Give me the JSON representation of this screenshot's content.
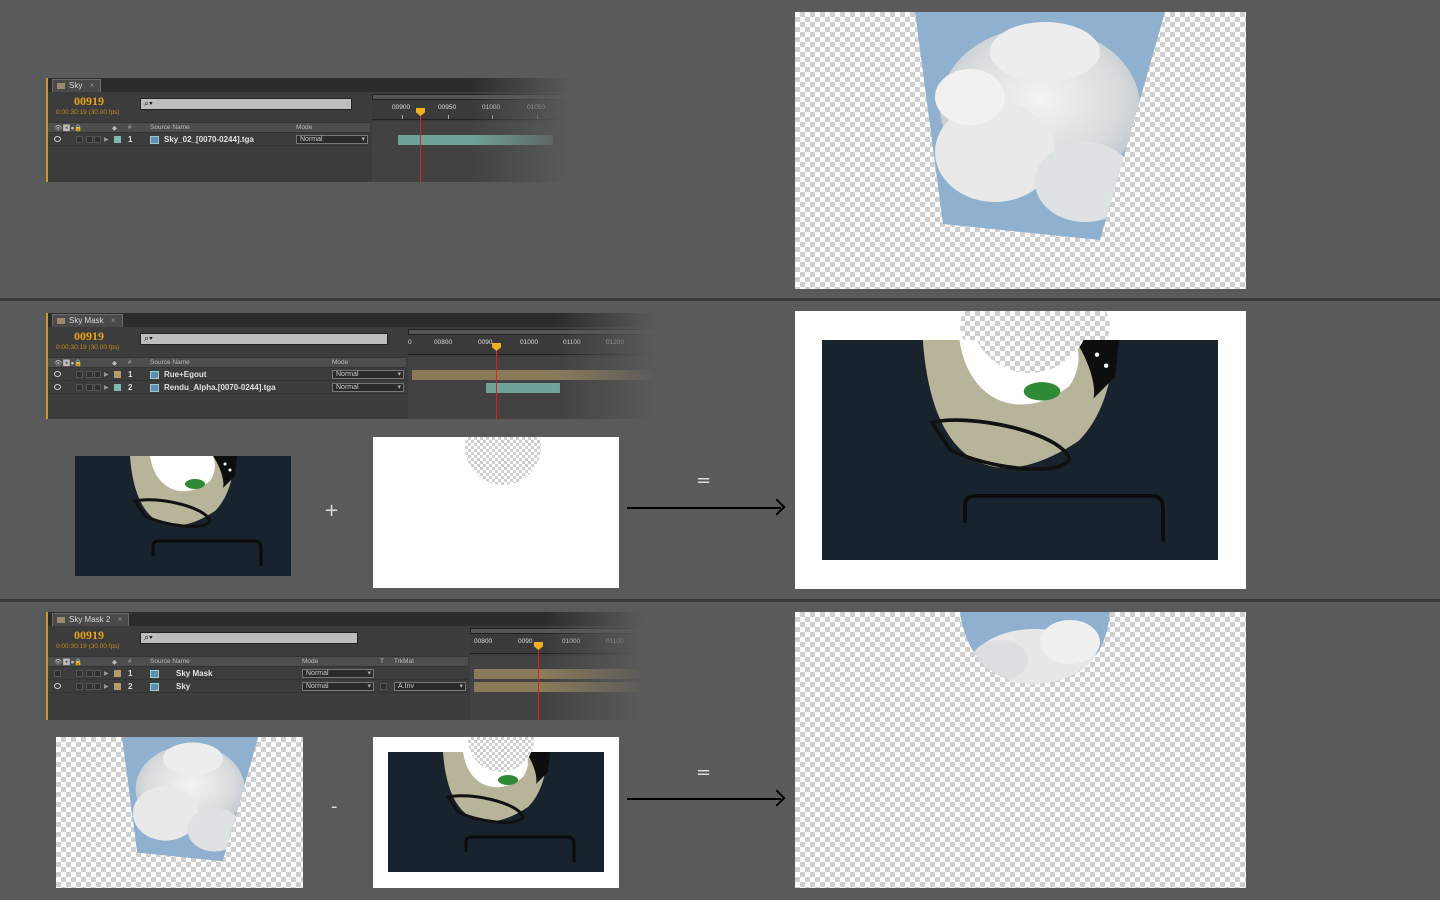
{
  "panels": {
    "sky": {
      "tab": "Sky",
      "timecode": "00919",
      "fps": "0:00:30:19 (30.00 fps)",
      "columns": {
        "source": "Source Name",
        "mode": "Mode"
      },
      "ruler": [
        "00900",
        "00950",
        "01000",
        "01050"
      ],
      "layers": [
        {
          "num": "1",
          "name": "Sky_02_[0070-0244].tga",
          "mode": "Normal"
        }
      ]
    },
    "sky_mask": {
      "tab": "Sky Mask",
      "timecode": "00919",
      "fps": "0:00:30:19 (30.00 fps)",
      "columns": {
        "source": "Source Name",
        "mode": "Mode"
      },
      "ruler": [
        "0",
        "00800",
        "0090",
        "01000",
        "01100",
        "01200"
      ],
      "layers": [
        {
          "num": "1",
          "name": "Rue+Egout",
          "mode": "Normal"
        },
        {
          "num": "2",
          "name": "Rendu_Alpha.[0070-0244].tga",
          "mode": "Normal"
        }
      ]
    },
    "sky_mask_2": {
      "tab": "Sky Mask 2",
      "timecode": "00919",
      "fps": "0:00:30:19 (30.00 fps)",
      "columns": {
        "source": "Source Name",
        "mode": "Mode",
        "t": "T",
        "trkmat": "TrkMat"
      },
      "ruler": [
        "00800",
        "0090",
        "01000",
        "01100"
      ],
      "layers": [
        {
          "num": "1",
          "name": "Sky Mask",
          "mode": "Normal",
          "trkmat": ""
        },
        {
          "num": "2",
          "name": "Sky",
          "mode": "Normal",
          "trkmat": "A.Inv"
        }
      ]
    }
  },
  "operators": {
    "plus": "+",
    "equals1": "=",
    "minus": "-",
    "equals2": "="
  },
  "icons": {
    "tab": "composition-icon",
    "search": "search-icon",
    "eye": "eye-icon",
    "arrow": "arrow-right-icon"
  },
  "colors": {
    "timecode": "#e8a21b",
    "cti": "#e02020",
    "clip_teal": "#6fa39a",
    "clip_tan": "#8a7a5a"
  }
}
